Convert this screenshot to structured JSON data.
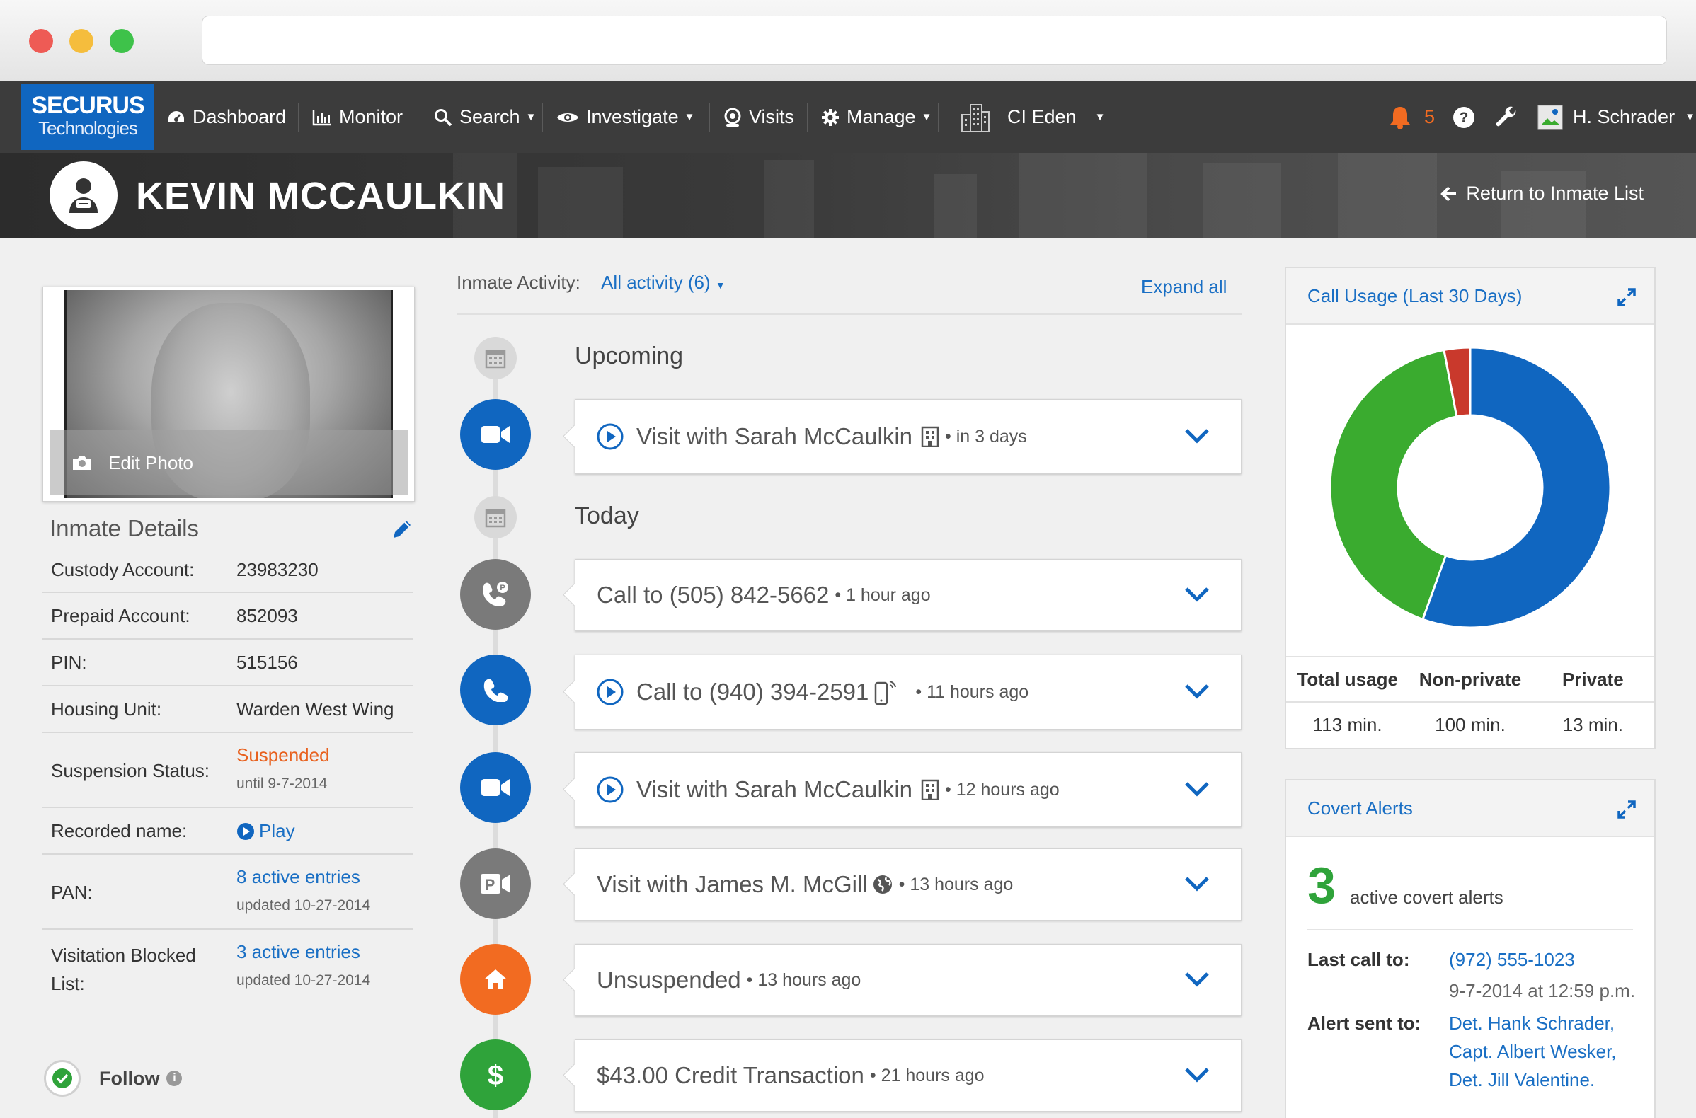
{
  "nav": {
    "logo_line1": "SECURUS",
    "logo_line2": "Technologies",
    "items": [
      {
        "label": "Dashboard",
        "icon": "dashboard-icon"
      },
      {
        "label": "Monitor",
        "icon": "bar-chart-icon"
      },
      {
        "label": "Search",
        "icon": "search-icon"
      },
      {
        "label": "Investigate",
        "icon": "eye-icon"
      },
      {
        "label": "Visits",
        "icon": "webcam-icon"
      },
      {
        "label": "Manage",
        "icon": "gear-icon"
      }
    ],
    "facility": "CI Eden",
    "alert_count": "5",
    "user": "H. Schrader",
    "alert_color": "#f26b21",
    "brand_color": "#1066c0"
  },
  "header": {
    "inmate_name": "KEVIN MCCAULKIN",
    "return_label": "Return to Inmate List"
  },
  "photo": {
    "edit_label": "Edit Photo"
  },
  "details": {
    "title": "Inmate Details",
    "rows": [
      {
        "label": "Custody Account:",
        "value": "23983230"
      },
      {
        "label": "Prepaid Account:",
        "value": "852093"
      },
      {
        "label": "PIN:",
        "value": "515156"
      },
      {
        "label": "Housing Unit:",
        "value": "Warden West Wing"
      },
      {
        "label": "Suspension Status:",
        "value": "Suspended",
        "sub": "until 9-7-2014"
      },
      {
        "label": "Recorded name:",
        "value": "Play"
      },
      {
        "label": "PAN:",
        "value": "8 active entries",
        "sub": "updated 10-27-2014"
      },
      {
        "label_line1": "Visitation Blocked",
        "label_line2": "List:",
        "value": "3 active entries",
        "sub": "updated 10-27-2014"
      }
    ],
    "follow_label": "Follow"
  },
  "activity": {
    "filter_label": "Inmate Activity:",
    "filter_value": "All activity (6)",
    "expand_all": "Expand all",
    "sections": {
      "upcoming": "Upcoming",
      "today": "Today"
    },
    "items": [
      {
        "title": "Visit with Sarah McCaulkin",
        "meta": "• in 3 days",
        "icon": "video-camera-icon"
      },
      {
        "title": "Call to (505) 842-5662",
        "meta": "• 1 hour ago",
        "icon": "phone-private-icon"
      },
      {
        "title": "Call to (940) 394-2591",
        "meta": "• 11 hours ago",
        "icon": "phone-icon"
      },
      {
        "title": "Visit with Sarah McCaulkin",
        "meta": "• 12 hours ago",
        "icon": "video-camera-icon"
      },
      {
        "title": "Visit with James M. McGill",
        "meta": "• 13 hours ago",
        "icon": "video-remote-icon"
      },
      {
        "title": "Unsuspended",
        "meta": "• 13 hours ago",
        "icon": "home-icon"
      },
      {
        "title": "$43.00 Credit Transaction",
        "meta": "• 21 hours ago",
        "icon": "dollar-icon"
      }
    ]
  },
  "call_usage": {
    "title": "Call Usage (Last 30 Days)",
    "headers": [
      "Total usage",
      "Non-private",
      "Private"
    ],
    "values": [
      "113 min.",
      "100 min.",
      "13 min."
    ]
  },
  "chart_data": {
    "type": "pie",
    "title": "Call Usage (Last 30 Days)",
    "slices": [
      {
        "label": "blue",
        "value": 55.5,
        "color": "#1066c0"
      },
      {
        "label": "green",
        "value": 41.5,
        "color": "#3aab2f"
      },
      {
        "label": "red",
        "value": 3.0,
        "color": "#c9392c"
      }
    ]
  },
  "covert": {
    "title": "Covert Alerts",
    "count": "3",
    "count_label": "active covert alerts",
    "last_call_label": "Last call to:",
    "last_call_number": "(972) 555-1023",
    "last_call_time": "9-7-2014 at 12:59 p.m.",
    "alert_sent_label": "Alert sent to:",
    "recipients": [
      "Det. Hank Schrader,",
      "Capt. Albert Wesker,",
      "Det. Jill Valentine."
    ]
  }
}
